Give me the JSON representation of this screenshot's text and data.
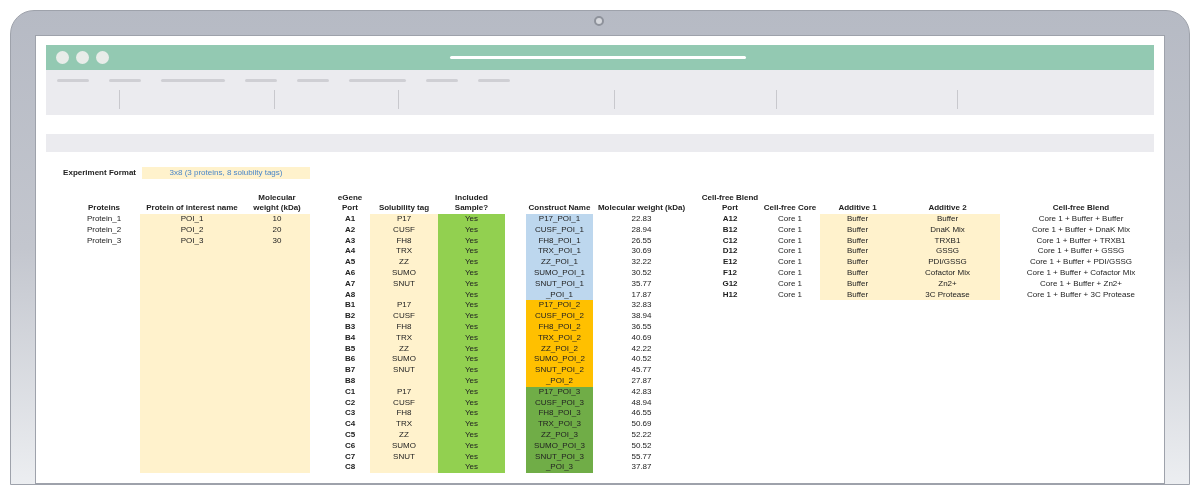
{
  "experiment_format": {
    "label": "Experiment Format",
    "value": "3x8 (3 proteins, 8 solubilty tags)"
  },
  "proteins": {
    "columns": [
      "Proteins",
      "Protein of interest name",
      "Molecular weight (kDa)"
    ],
    "rows": [
      {
        "protein": "Protein_1",
        "poi_name": "POI_1",
        "molecular_weight": "10"
      },
      {
        "protein": "Protein_2",
        "poi_name": "POI_2",
        "molecular_weight": "20"
      },
      {
        "protein": "Protein_3",
        "poi_name": "POI_3",
        "molecular_weight": "30"
      }
    ]
  },
  "constructs": {
    "columns": [
      "eGene Port",
      "Solubility tag",
      "Included Sample?",
      "Construct Name",
      "Molecular weight (kDa)"
    ],
    "rows": [
      {
        "port": "A1",
        "tag": "P17",
        "included": "Yes",
        "construct": "P17_POI_1",
        "color": "#bdd7ee",
        "molecular_weight": "22.83"
      },
      {
        "port": "A2",
        "tag": "CUSF",
        "included": "Yes",
        "construct": "CUSF_POI_1",
        "color": "#bdd7ee",
        "molecular_weight": "28.94"
      },
      {
        "port": "A3",
        "tag": "FH8",
        "included": "Yes",
        "construct": "FH8_POI_1",
        "color": "#bdd7ee",
        "molecular_weight": "26.55"
      },
      {
        "port": "A4",
        "tag": "TRX",
        "included": "Yes",
        "construct": "TRX_POI_1",
        "color": "#bdd7ee",
        "molecular_weight": "30.69"
      },
      {
        "port": "A5",
        "tag": "ZZ",
        "included": "Yes",
        "construct": "ZZ_POI_1",
        "color": "#bdd7ee",
        "molecular_weight": "32.22"
      },
      {
        "port": "A6",
        "tag": "SUMO",
        "included": "Yes",
        "construct": "SUMO_POI_1",
        "color": "#bdd7ee",
        "molecular_weight": "30.52"
      },
      {
        "port": "A7",
        "tag": "SNUT",
        "included": "Yes",
        "construct": "SNUT_POI_1",
        "color": "#bdd7ee",
        "molecular_weight": "35.77"
      },
      {
        "port": "A8",
        "included": "Yes",
        "construct": "_POI_1",
        "color": "#bdd7ee",
        "molecular_weight": "17.87"
      },
      {
        "port": "B1",
        "tag": "P17",
        "included": "Yes",
        "construct": "P17_POI_2",
        "color": "#ffc000",
        "molecular_weight": "32.83"
      },
      {
        "port": "B2",
        "tag": "CUSF",
        "included": "Yes",
        "construct": "CUSF_POI_2",
        "color": "#ffc000",
        "molecular_weight": "38.94"
      },
      {
        "port": "B3",
        "tag": "FH8",
        "included": "Yes",
        "construct": "FH8_POI_2",
        "color": "#ffc000",
        "molecular_weight": "36.55"
      },
      {
        "port": "B4",
        "tag": "TRX",
        "included": "Yes",
        "construct": "TRX_POI_2",
        "color": "#ffc000",
        "molecular_weight": "40.69"
      },
      {
        "port": "B5",
        "tag": "ZZ",
        "included": "Yes",
        "construct": "ZZ_POI_2",
        "color": "#ffc000",
        "molecular_weight": "42.22"
      },
      {
        "port": "B6",
        "tag": "SUMO",
        "included": "Yes",
        "construct": "SUMO_POI_2",
        "color": "#ffc000",
        "molecular_weight": "40.52"
      },
      {
        "port": "B7",
        "tag": "SNUT",
        "included": "Yes",
        "construct": "SNUT_POI_2",
        "color": "#ffc000",
        "molecular_weight": "45.77"
      },
      {
        "port": "B8",
        "included": "Yes",
        "construct": "_POI_2",
        "color": "#ffc000",
        "molecular_weight": "27.87"
      },
      {
        "port": "C1",
        "tag": "P17",
        "included": "Yes",
        "construct": "P17_POI_3",
        "color": "#70ad47",
        "molecular_weight": "42.83"
      },
      {
        "port": "C2",
        "tag": "CUSF",
        "included": "Yes",
        "construct": "CUSF_POI_3",
        "color": "#70ad47",
        "molecular_weight": "48.94"
      },
      {
        "port": "C3",
        "tag": "FH8",
        "included": "Yes",
        "construct": "FH8_POI_3",
        "color": "#70ad47",
        "molecular_weight": "46.55"
      },
      {
        "port": "C4",
        "tag": "TRX",
        "included": "Yes",
        "construct": "TRX_POI_3",
        "color": "#70ad47",
        "molecular_weight": "50.69"
      },
      {
        "port": "C5",
        "tag": "ZZ",
        "included": "Yes",
        "construct": "ZZ_POI_3",
        "color": "#70ad47",
        "molecular_weight": "52.22"
      },
      {
        "port": "C6",
        "tag": "SUMO",
        "included": "Yes",
        "construct": "SUMO_POI_3",
        "color": "#70ad47",
        "molecular_weight": "50.52"
      },
      {
        "port": "C7",
        "tag": "SNUT",
        "included": "Yes",
        "construct": "SNUT_POI_3",
        "color": "#70ad47",
        "molecular_weight": "55.77"
      },
      {
        "port": "C8",
        "included": "Yes",
        "construct": "_POI_3",
        "color": "#70ad47",
        "molecular_weight": "37.87"
      }
    ]
  },
  "blends": {
    "columns": [
      "Cell-free Blend Port",
      "Cell-free Core",
      "Additive 1",
      "Additive 2",
      "Cell-free Blend"
    ],
    "rows": [
      {
        "port": "A12",
        "core": "Core 1",
        "additive_1": "Buffer",
        "additive_2": "Buffer",
        "blend": "Core 1 + Buffer + Buffer"
      },
      {
        "port": "B12",
        "core": "Core 1",
        "additive_1": "Buffer",
        "additive_2": "DnaK Mix",
        "blend": "Core 1 + Buffer + DnaK Mix"
      },
      {
        "port": "C12",
        "core": "Core 1",
        "additive_1": "Buffer",
        "additive_2": "TRXB1",
        "blend": "Core 1 + Buffer + TRXB1"
      },
      {
        "port": "D12",
        "core": "Core 1",
        "additive_1": "Buffer",
        "additive_2": "GSSG",
        "blend": "Core 1 + Buffer + GSSG"
      },
      {
        "port": "E12",
        "core": "Core 1",
        "additive_1": "Buffer",
        "additive_2": "PDI/GSSG",
        "blend": "Core 1 + Buffer + PDI/GSSG"
      },
      {
        "port": "F12",
        "core": "Core 1",
        "additive_1": "Buffer",
        "additive_2": "Cofactor Mix",
        "blend": "Core 1 + Buffer + Cofactor Mix"
      },
      {
        "port": "G12",
        "core": "Core 1",
        "additive_1": "Buffer",
        "additive_2": "Zn2+",
        "blend": "Core 1 + Buffer + Zn2+"
      },
      {
        "port": "H12",
        "core": "Core 1",
        "additive_1": "Buffer",
        "additive_2": "3C Protease",
        "blend": "Core 1 + Buffer + 3C Protease"
      }
    ]
  }
}
